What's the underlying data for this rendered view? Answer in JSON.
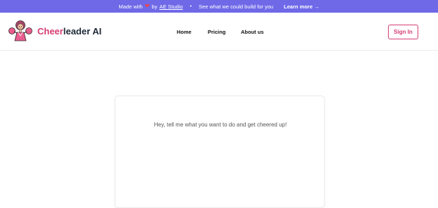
{
  "promo": {
    "made_with": "Made with",
    "by": "by",
    "studio_link": "AE Studio",
    "separator": "•",
    "tagline": "See what we could build for you",
    "learn_more": "Learn more →",
    "heart_icon": "heart-icon"
  },
  "header": {
    "brand_accent": "Cheer",
    "brand_rest": "leader AI",
    "nav": {
      "home": "Home",
      "pricing": "Pricing",
      "about": "About us"
    },
    "sign_in": "Sign In"
  },
  "main": {
    "prompt": "Hey, tell me what you want to do and get cheered up!"
  },
  "colors": {
    "banner": "#6f69e8",
    "brand_accent": "#d63d74",
    "heart": "#ef4444"
  }
}
